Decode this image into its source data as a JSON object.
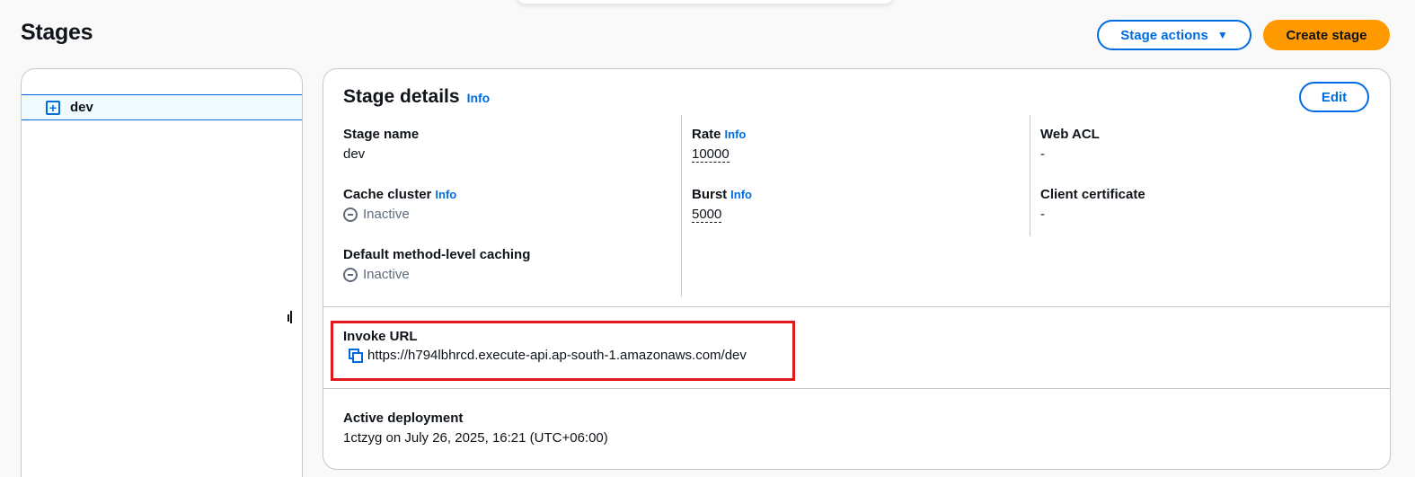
{
  "header": {
    "title": "Stages",
    "stage_actions_label": "Stage actions",
    "create_stage_label": "Create stage"
  },
  "tree": {
    "items": [
      {
        "label": "dev",
        "expand_icon": "plus-square-icon"
      }
    ]
  },
  "details": {
    "heading": "Stage details",
    "info_label": "Info",
    "edit_label": "Edit",
    "stage_name": {
      "label": "Stage name",
      "value": "dev"
    },
    "cache_cluster": {
      "label": "Cache cluster",
      "info": "Info",
      "value": "Inactive"
    },
    "default_caching": {
      "label": "Default method-level caching",
      "value": "Inactive"
    },
    "rate": {
      "label": "Rate",
      "info": "Info",
      "value": "10000"
    },
    "burst": {
      "label": "Burst",
      "info": "Info",
      "value": "5000"
    },
    "web_acl": {
      "label": "Web ACL",
      "value": "-"
    },
    "client_certificate": {
      "label": "Client certificate",
      "value": "-"
    },
    "invoke_url": {
      "label": "Invoke URL",
      "value": "https://h794lbhrcd.execute-api.ap-south-1.amazonaws.com/dev"
    },
    "active_deployment": {
      "label": "Active deployment",
      "value": "1ctzyg on July 26, 2025, 16:21 (UTC+06:00)"
    }
  },
  "colors": {
    "accent": "#006ce0",
    "primary_button": "#ff9900",
    "highlight": "#e0191f"
  }
}
